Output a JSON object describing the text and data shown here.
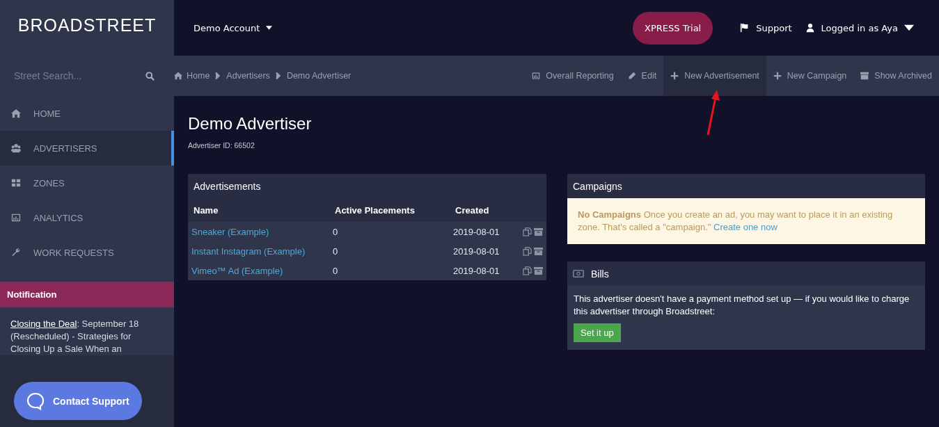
{
  "header": {
    "logo": "**BROAD**STREET",
    "account": "Demo Account",
    "trial_button": "XPRESS Trial",
    "support": "Support",
    "user": "Logged in as Aya"
  },
  "sidebar": {
    "search": {
      "placeholder": "Street Search..."
    },
    "nav": [
      {
        "label": "HOME",
        "selected": false
      },
      {
        "label": "ADVERTISERS",
        "selected": true
      },
      {
        "label": "ZONES",
        "selected": false
      },
      {
        "label": "ANALYTICS",
        "selected": false
      },
      {
        "label": "WORK REQUESTS",
        "selected": false
      }
    ],
    "notification": {
      "title": "Notification",
      "link": "Closing the Deal",
      "text": ": September 18 (Rescheduled) - Strategies for Closing Up a Sale When an"
    },
    "contact_button": "Contact Support"
  },
  "breadcrumbs": [
    "Home",
    "Advertisers",
    "Demo Advertiser"
  ],
  "toolbar": [
    {
      "label": "Overall Reporting",
      "selected": false
    },
    {
      "label": "Edit",
      "selected": false
    },
    {
      "label": "New Advertisement",
      "selected": true
    },
    {
      "label": "New Campaign",
      "selected": false
    },
    {
      "label": "Show Archived",
      "selected": false
    }
  ],
  "page": {
    "title": "Demo Advertiser",
    "subtitle": "Advertiser ID: 66502"
  },
  "advertisements": {
    "title": "Advertisements",
    "columns": [
      "Name",
      "Active Placements",
      "Created"
    ],
    "rows": [
      {
        "name": "Sneaker (Example)",
        "active_placements": "0",
        "created": "2019-08-01"
      },
      {
        "name": "Instant Instagram (Example)",
        "active_placements": "0",
        "created": "2019-08-01"
      },
      {
        "name": "Vimeo™ Ad (Example)",
        "active_placements": "0",
        "created": "2019-08-01"
      }
    ]
  },
  "campaigns": {
    "title": "Campaigns",
    "alert": "**No Campaigns** Once you create an ad, you may want to place it in an existing zone. That's called a \"campaign.\"",
    "link": "Create one now"
  },
  "bills": {
    "title": "Bills",
    "text": "This advertiser doesn't have a payment method set up — if you would like to charge this advertiser through Broadstreet:",
    "button": "Set it up"
  }
}
